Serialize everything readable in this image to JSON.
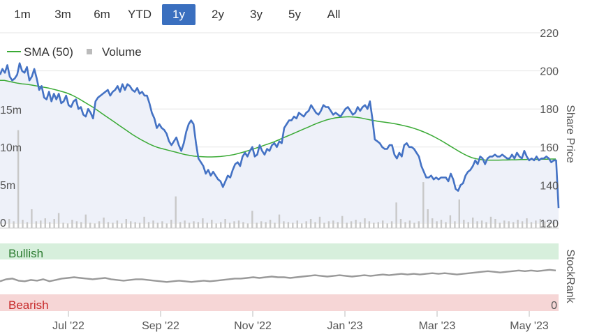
{
  "range_selector": {
    "buttons": [
      "1m",
      "3m",
      "6m",
      "YTD",
      "1y",
      "2y",
      "3y",
      "5y",
      "All"
    ],
    "active": "1y"
  },
  "legend": {
    "sma_label": "SMA (50)",
    "volume_label": "Volume"
  },
  "colors": {
    "price": "#4472c4",
    "sma": "#3aaa35",
    "volume": "#c8c8c8",
    "stockrank": "#999999",
    "bullish_bg": "#d7efdc",
    "bullish_text": "#2e7d32",
    "bearish_bg": "#f6d6d6",
    "bearish_text": "#c62828",
    "active_button": "#3a6fbf"
  },
  "chart_data": [
    {
      "type": "line",
      "x_ticks": [
        "Jul '22",
        "Sep '22",
        "Nov '22",
        "Jan '23",
        "Mar '23",
        "May '23"
      ],
      "y_axis": {
        "title": "Share Price",
        "ticks": [
          120,
          140,
          160,
          180,
          200,
          220
        ],
        "ylim": [
          120,
          220
        ]
      },
      "volume_axis": {
        "ticks": [
          "0",
          "5m",
          "10m",
          "15m"
        ],
        "vlim": [
          0,
          15
        ]
      },
      "series": [
        {
          "name": "Share Price",
          "values": [
            198,
            201,
            199,
            203,
            197,
            195,
            196,
            198,
            204,
            200,
            199,
            202,
            195,
            197,
            201,
            196,
            190,
            192,
            186,
            185,
            189,
            184,
            188,
            185,
            188,
            183,
            184,
            187,
            182,
            181,
            184,
            185,
            180,
            181,
            177,
            176,
            180,
            178,
            175,
            184,
            186,
            187,
            188,
            189,
            190,
            187,
            189,
            190,
            192,
            189,
            193,
            190,
            193,
            192,
            190,
            189,
            191,
            188,
            189,
            187,
            187,
            183,
            178,
            175,
            170,
            172,
            170,
            169,
            167,
            163,
            161,
            163,
            165,
            161,
            158,
            162,
            168,
            172,
            174,
            172,
            162,
            154,
            152,
            150,
            146,
            148,
            145,
            147,
            145,
            143,
            142,
            139,
            142,
            145,
            144,
            148,
            151,
            152,
            150,
            155,
            157,
            155,
            158,
            160,
            155,
            156,
            161,
            158,
            156,
            159,
            158,
            161,
            162,
            160,
            163,
            162,
            170,
            172,
            174,
            174,
            176,
            175,
            178,
            177,
            176,
            178,
            179,
            182,
            180,
            178,
            177,
            179,
            182,
            181,
            181,
            179,
            177,
            178,
            177,
            176,
            178,
            180,
            181,
            179,
            177,
            178,
            181,
            179,
            181,
            182,
            180,
            184,
            175,
            164,
            163,
            162,
            160,
            159,
            159,
            161,
            161,
            156,
            154,
            157,
            155,
            161,
            162,
            160,
            160,
            159,
            157,
            155,
            150,
            147,
            144,
            144,
            145,
            143,
            144,
            143,
            144,
            144,
            144,
            142,
            146,
            143,
            138,
            137,
            140,
            141,
            145,
            147,
            148,
            150,
            153,
            151,
            155,
            154,
            151,
            154,
            155,
            155,
            156,
            155,
            155,
            156,
            155,
            154,
            154,
            156,
            154,
            157,
            155,
            154,
            158,
            155,
            153,
            154,
            153,
            155,
            153,
            154,
            154,
            155,
            154,
            152,
            153,
            153,
            128
          ]
        },
        {
          "name": "SMA (50)",
          "values": [
            195,
            195,
            194.5,
            194,
            193.5,
            193.2,
            193,
            192.6,
            192.2,
            191.8,
            191.4,
            191,
            190.4,
            189.8,
            189.2,
            188.5,
            187.6,
            186.5,
            185.2,
            183.8,
            182.4,
            181,
            179.4,
            177.8,
            176.2,
            174.6,
            173,
            171.4,
            169.8,
            168.2,
            166.6,
            165.2,
            163.8,
            162.6,
            161.4,
            160.4,
            159.6,
            159,
            158.4,
            157.8,
            157.2,
            156.6,
            156,
            155.6,
            155.2,
            155,
            154.9,
            154.8,
            154.8,
            154.9,
            155,
            155.3,
            155.6,
            156,
            156.6,
            157.2,
            157.9,
            158.6,
            159.4,
            160.2,
            161,
            161.8,
            162.6,
            163.6,
            164.6,
            165.6,
            166.6,
            167.6,
            168.6,
            169.6,
            170.6,
            171.6,
            172.6,
            173.4,
            174.2,
            174.8,
            175.3,
            175.6,
            175.8,
            175.9,
            175.8,
            175.6,
            175.2,
            174.7,
            174.2,
            173.8,
            173.4,
            173.1,
            172.8,
            172.4,
            172,
            171.5,
            171,
            170.4,
            169.7,
            168.9,
            168,
            167,
            165.9,
            164.7,
            163.4,
            162,
            160.6,
            159.2,
            157.8,
            156.5,
            155.3,
            154.4,
            153.8,
            153.4,
            153.2,
            153.1,
            153.1,
            153.1,
            153.2,
            153.2,
            153.3,
            153.3,
            153.4,
            153.4,
            153.5,
            153.5,
            153.5,
            153.6,
            153.6,
            153.7,
            153.7
          ]
        }
      ],
      "volume_m": [
        1.2,
        0.9,
        13,
        1.1,
        0.8,
        2.5,
        0.9,
        1,
        1.3,
        0.8,
        1.2,
        2,
        0.7,
        0.6,
        1.1,
        0.9,
        0.8,
        1.8,
        0.7,
        0.6,
        0.9,
        1.4,
        0.8,
        0.7,
        1,
        0.6,
        1.2,
        0.9,
        0.8,
        0.7,
        1.5,
        0.8,
        1,
        0.7,
        0.9,
        0.6,
        1.1,
        4.2,
        0.8,
        1,
        0.7,
        0.9,
        0.8,
        1.3,
        0.7,
        1.1,
        0.6,
        0.8,
        1.2,
        0.7,
        0.9,
        1,
        0.8,
        0.6,
        2.3,
        0.7,
        0.9,
        0.8,
        1.1,
        0.7,
        1.8,
        0.9,
        0.8,
        0.7,
        1,
        0.6,
        0.9,
        1.2,
        0.8,
        1.5,
        0.7,
        0.9,
        1,
        0.8,
        1.6,
        0.7,
        0.9,
        1.1,
        0.8,
        1.3,
        0.9,
        0.7,
        0.8,
        1,
        0.6,
        0.9,
        3.4,
        1.2,
        0.8,
        1,
        0.7,
        0.9,
        6.1,
        2.5,
        1.3,
        0.9,
        1.1,
        0.8,
        1.7,
        0.9,
        3.8,
        1.1,
        0.8,
        1.4,
        0.9,
        1,
        0.8,
        1.5,
        1.2,
        0.7,
        1,
        0.9,
        0.8,
        1.1,
        0.9,
        1.3,
        0.8,
        1,
        1.2,
        0.9,
        0.8,
        1.1
      ],
      "volume_x_end_index": 122
    },
    {
      "type": "line",
      "title": "StockRank",
      "band_labels": {
        "top": "Bullish",
        "bottom": "Bearish"
      },
      "y_ticks": [
        "0"
      ],
      "ylim": [
        0,
        100
      ],
      "series": [
        {
          "name": "StockRank",
          "values": [
            44,
            47,
            48,
            45,
            44,
            46,
            45,
            47,
            44,
            46,
            48,
            49,
            50,
            49,
            48,
            47,
            48,
            49,
            47,
            46,
            45,
            46,
            47,
            47,
            46,
            45,
            44,
            43,
            44,
            45,
            44,
            43,
            44,
            45,
            44,
            45,
            46,
            47,
            48,
            48,
            49,
            50,
            49,
            50,
            51,
            50,
            50,
            49,
            50,
            51,
            52,
            53,
            52,
            51,
            52,
            53,
            52,
            51,
            52,
            53,
            52,
            53,
            54,
            53,
            54,
            55,
            54,
            55,
            54,
            55,
            56,
            55,
            56,
            55,
            54,
            55,
            56,
            57,
            58,
            59,
            58,
            57,
            58,
            59,
            60,
            59,
            60,
            59,
            60,
            61,
            60
          ]
        }
      ]
    }
  ]
}
